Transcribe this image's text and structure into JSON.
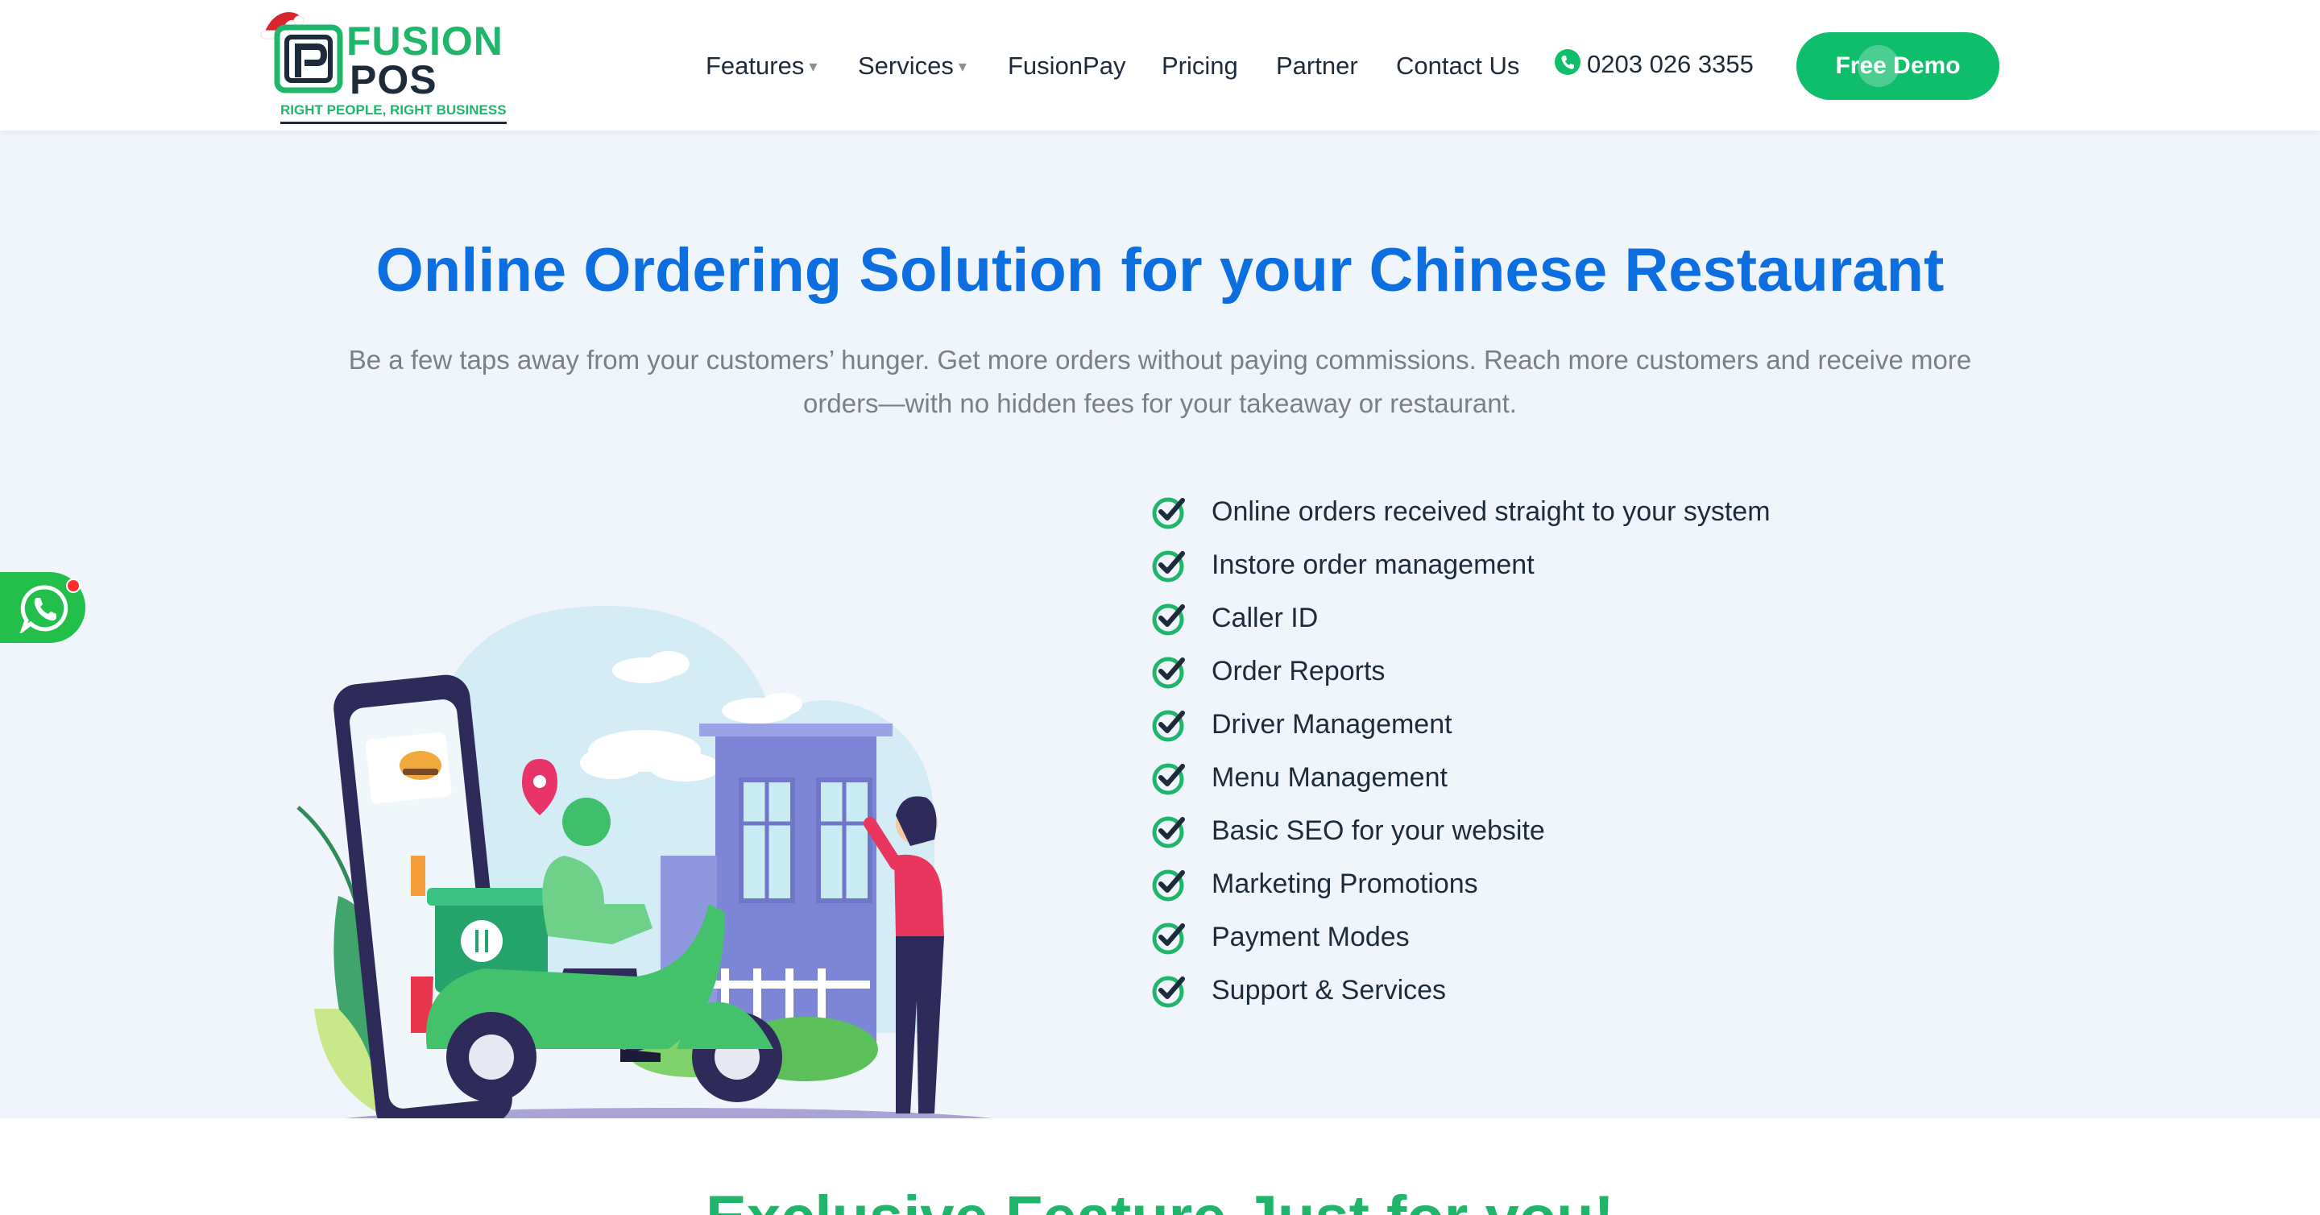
{
  "brand": {
    "name_line1": "FUSION",
    "name_line2": "POS",
    "tagline": "RIGHT PEOPLE, RIGHT BUSINESS",
    "primary_color": "#1fb56a",
    "dark_color": "#1d2b3a"
  },
  "nav": {
    "items": [
      {
        "label": "Features",
        "has_dropdown": true
      },
      {
        "label": "Services",
        "has_dropdown": true
      },
      {
        "label": "FusionPay",
        "has_dropdown": false
      },
      {
        "label": "Pricing",
        "has_dropdown": false
      },
      {
        "label": "Partner",
        "has_dropdown": false
      },
      {
        "label": "Contact Us",
        "has_dropdown": false
      }
    ],
    "caret": "▾",
    "phone": "0203 026 3355",
    "phone_icon": "phone-icon",
    "cta_label": "Free Demo",
    "cta_color": "#0fbe6b"
  },
  "hero": {
    "title": "Online Ordering Solution for your Chinese Restaurant",
    "description_line1": "Be a few taps away from your customers’ hunger. Get more orders without paying commissions. Reach more customers and receive more",
    "description_line2": "orders—with no hidden fees for your takeaway or restaurant.",
    "title_color": "#0d6ee0",
    "background": "#f0f5fb",
    "illustration": "delivery-scooter-illustration",
    "features": [
      "Online orders received straight to your system",
      "Instore order management",
      "Caller ID",
      "Order Reports",
      "Driver Management",
      "Menu Management",
      "Basic SEO for your website",
      "Marketing Promotions",
      "Payment Modes",
      "Support & Services"
    ],
    "feature_icon": "check-circle-icon"
  },
  "whatsapp": {
    "icon": "whatsapp-icon",
    "color": "#22c04b"
  },
  "section2": {
    "title": "Exclusive Feature Just for you!"
  }
}
